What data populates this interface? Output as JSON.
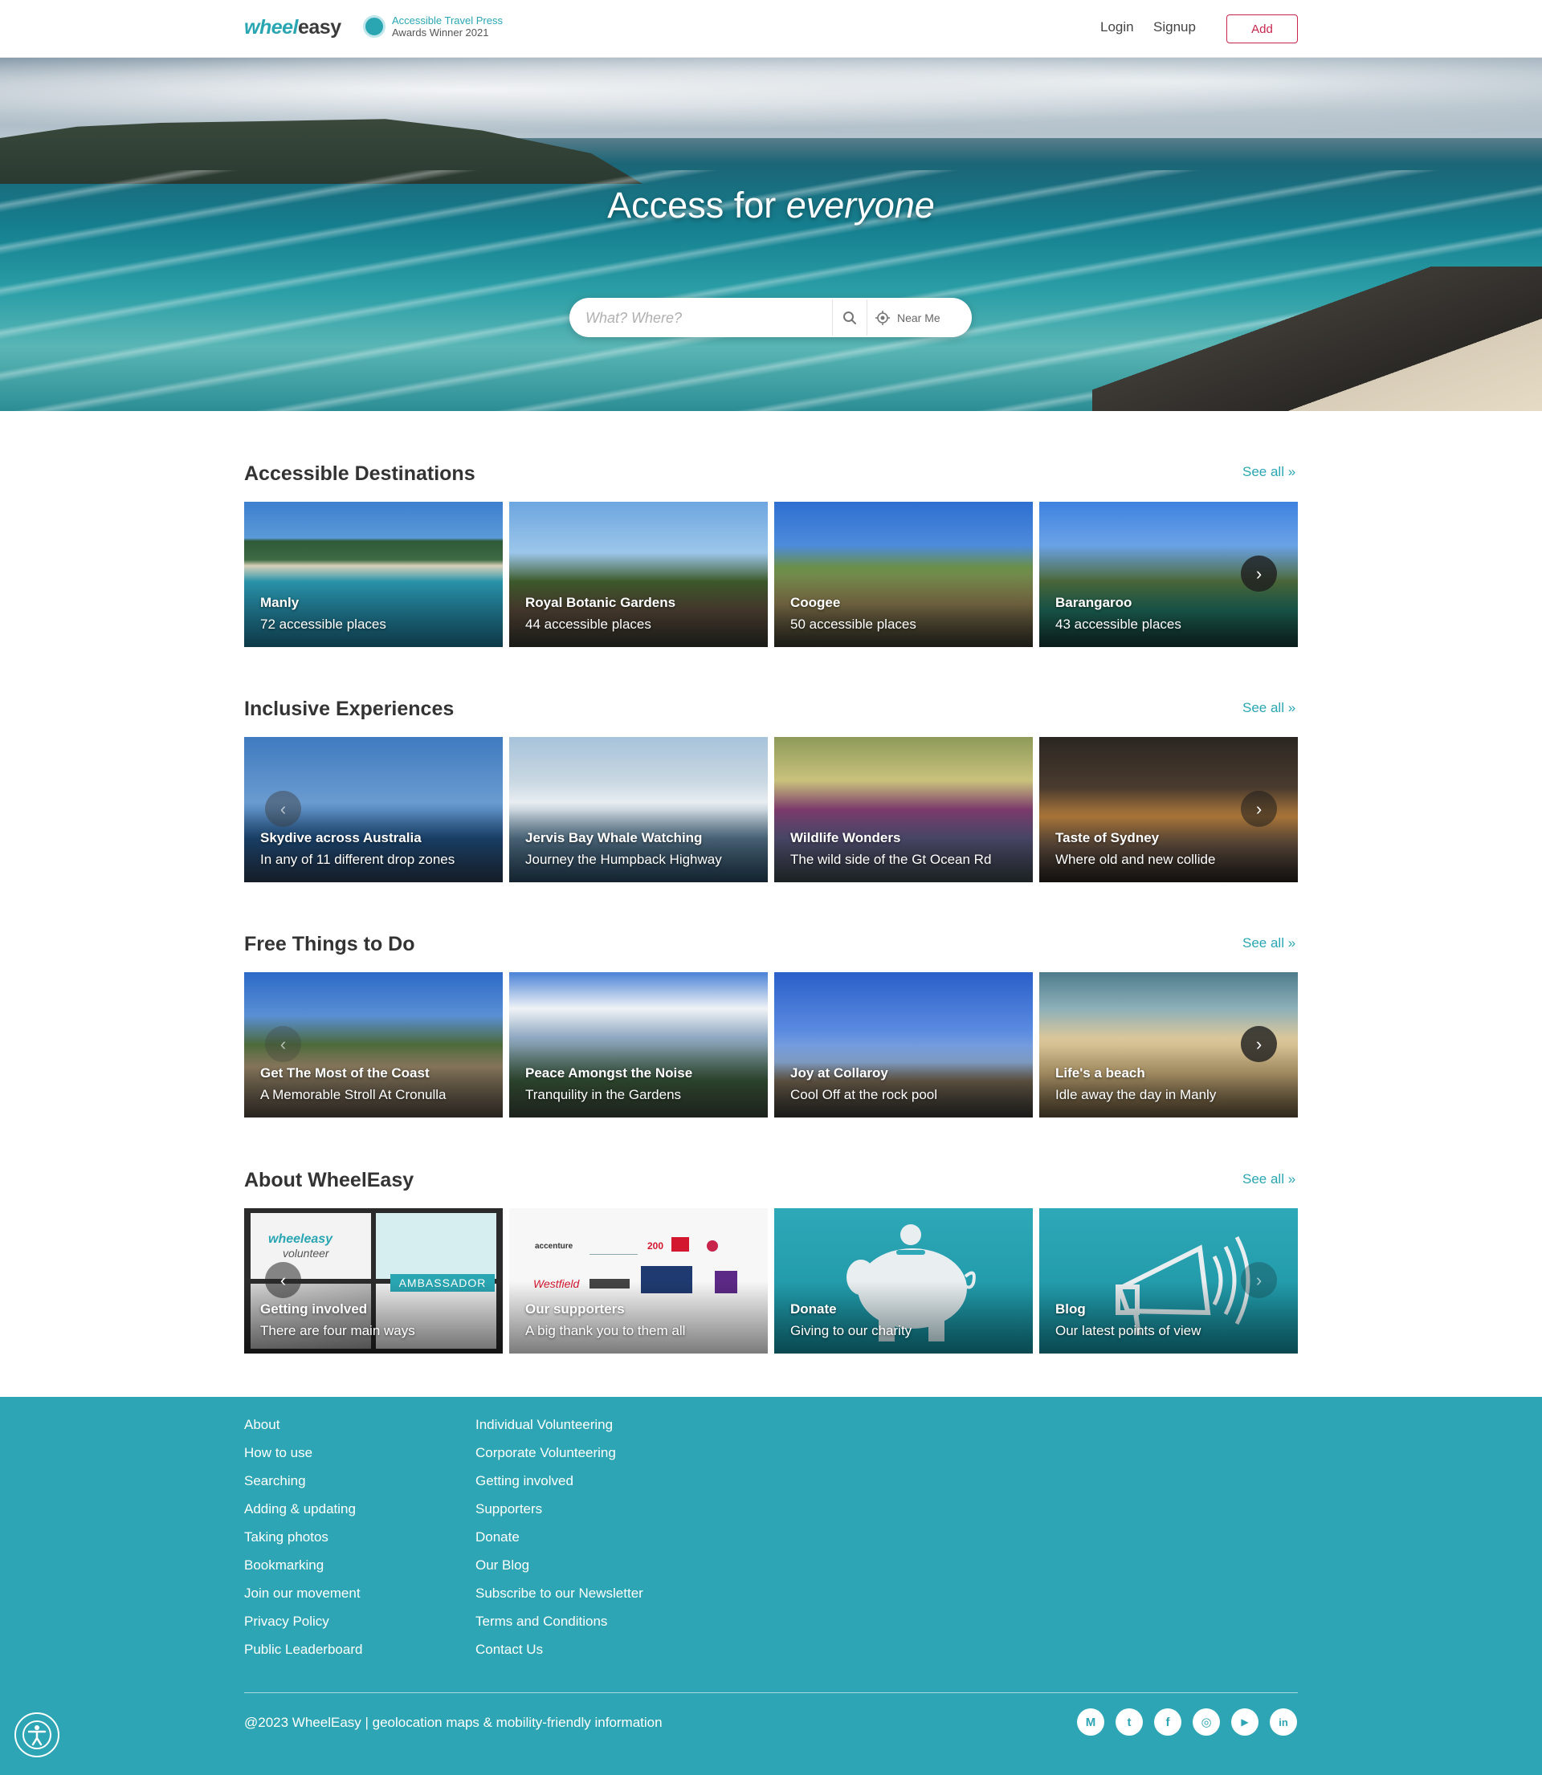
{
  "header": {
    "logo_part1": "wheel",
    "logo_part2": "easy",
    "award_line1": "Accessible Travel Press",
    "award_line2": "Awards Winner 2021",
    "login": "Login",
    "signup": "Signup",
    "add": "Add"
  },
  "hero": {
    "title_plain": "Access for ",
    "title_emph": "everyone",
    "search_placeholder": "What? Where?",
    "near_me": "Near Me"
  },
  "sections": [
    {
      "title": "Accessible Destinations",
      "see_all": "See all »",
      "cards": [
        {
          "title": "Manly",
          "subtitle": "72 accessible places"
        },
        {
          "title": "Royal Botanic Gardens",
          "subtitle": "44 accessible places"
        },
        {
          "title": "Coogee",
          "subtitle": "50 accessible places"
        },
        {
          "title": "Barangaroo",
          "subtitle": "43 accessible places"
        }
      ]
    },
    {
      "title": "Inclusive Experiences",
      "see_all": "See all »",
      "cards": [
        {
          "title": "Skydive across Australia",
          "subtitle": "In any of 11 different drop zones"
        },
        {
          "title": "Jervis Bay Whale Watching",
          "subtitle": "Journey the Humpback Highway"
        },
        {
          "title": "Wildlife Wonders",
          "subtitle": "The wild side of the Gt Ocean Rd"
        },
        {
          "title": "Taste of Sydney",
          "subtitle": "Where old and new collide"
        }
      ]
    },
    {
      "title": "Free Things to Do",
      "see_all": "See all »",
      "cards": [
        {
          "title": "Get The Most of the Coast",
          "subtitle": "A Memorable Stroll At Cronulla"
        },
        {
          "title": "Peace Amongst the Noise",
          "subtitle": "Tranquility in the Gardens"
        },
        {
          "title": "Joy at Collaroy",
          "subtitle": "Cool Off at the rock pool"
        },
        {
          "title": "Life's a beach",
          "subtitle": "Idle away the day in Manly"
        }
      ]
    },
    {
      "title": "About WheelEasy",
      "see_all": "See all »",
      "cards": [
        {
          "title": "Getting involved",
          "subtitle": "There are four main ways"
        },
        {
          "title": "Our supporters",
          "subtitle": "A big thank you to them all"
        },
        {
          "title": "Donate",
          "subtitle": "Giving to our charity"
        },
        {
          "title": "Blog",
          "subtitle": "Our latest points of view"
        }
      ]
    }
  ],
  "about_art": {
    "volunteer_logo1": "wheeleasy",
    "volunteer_logo2": "volunteer",
    "ambassador": "AMBASSADOR",
    "supporter_logos": [
      "accenture",
      "Westfield",
      "200"
    ]
  },
  "footer": {
    "col1": [
      "About",
      "How to use",
      "Searching",
      "Adding & updating",
      "Taking photos",
      "Bookmarking",
      "Join our movement",
      "Privacy Policy",
      "Public Leaderboard"
    ],
    "col2": [
      "Individual Volunteering",
      "Corporate Volunteering",
      "Getting involved",
      "Supporters",
      "Donate",
      "Our Blog",
      "Subscribe to our Newsletter",
      "Terms and Conditions",
      "Contact Us"
    ],
    "copyright": "@2023 WheelEasy | geolocation maps & mobility-friendly information",
    "social": [
      {
        "icon": "medium-icon",
        "glyph": "M"
      },
      {
        "icon": "twitter-icon",
        "glyph": "t"
      },
      {
        "icon": "facebook-icon",
        "glyph": "f"
      },
      {
        "icon": "instagram-icon",
        "glyph": "◎"
      },
      {
        "icon": "youtube-icon",
        "glyph": "▶"
      },
      {
        "icon": "linkedin-icon",
        "glyph": "in"
      }
    ]
  },
  "colors": {
    "brand_teal": "#2da5b4",
    "add_button_red": "#c8254c"
  }
}
